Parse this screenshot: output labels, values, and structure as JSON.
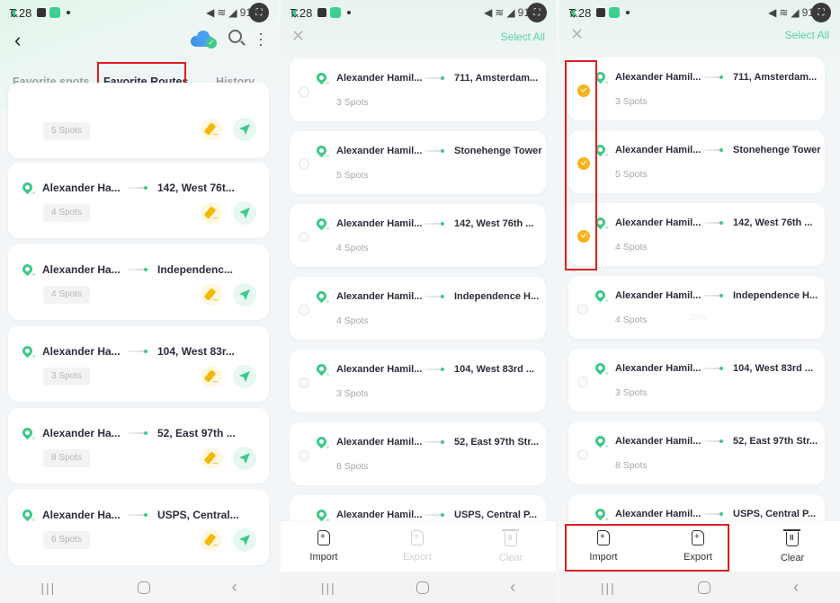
{
  "status_bar": {
    "time": "7:28",
    "battery": "91"
  },
  "panel1": {
    "tabs": [
      {
        "label": "Favorite spots",
        "active": false
      },
      {
        "label": "Favorite Routes",
        "active": true
      },
      {
        "label": "History",
        "active": false
      }
    ],
    "icons": {
      "back": "back-arrow-icon",
      "cloud": "cloud-sync-icon",
      "search": "search-icon",
      "menu": "more-vertical-icon"
    },
    "routes": [
      {
        "from": "",
        "to": "",
        "spots": "5 Spots"
      },
      {
        "from": "Alexander Ha...",
        "to": "142, West 76t...",
        "spots": "4 Spots"
      },
      {
        "from": "Alexander Ha...",
        "to": "Independenc...",
        "spots": "4 Spots"
      },
      {
        "from": "Alexander Ha...",
        "to": "104, West 83r...",
        "spots": "3 Spots"
      },
      {
        "from": "Alexander Ha...",
        "to": "52, East 97th ...",
        "spots": "8 Spots"
      },
      {
        "from": "Alexander Ha...",
        "to": "USPS, Central...",
        "spots": "6 Spots"
      }
    ]
  },
  "panel2": {
    "select_all": "Select All",
    "routes": [
      {
        "from": "Alexander Hamil...",
        "to": "711, Amsterdam...",
        "spots": "3 Spots",
        "checked": false
      },
      {
        "from": "Alexander Hamil...",
        "to": "Stonehenge Tower",
        "spots": "5 Spots",
        "checked": false
      },
      {
        "from": "Alexander Hamil...",
        "to": "142, West 76th ...",
        "spots": "4 Spots",
        "checked": false
      },
      {
        "from": "Alexander Hamil...",
        "to": "Independence H...",
        "spots": "4 Spots",
        "checked": false
      },
      {
        "from": "Alexander Hamil...",
        "to": "104, West 83rd ...",
        "spots": "3 Spots",
        "checked": false
      },
      {
        "from": "Alexander Hamil...",
        "to": "52, East 97th Str...",
        "spots": "8 Spots",
        "checked": false
      },
      {
        "from": "Alexander Hamil...",
        "to": "USPS, Central P...",
        "spots": "",
        "checked": false
      }
    ],
    "actions": [
      {
        "label": "Import",
        "enabled": true
      },
      {
        "label": "Export",
        "enabled": false
      },
      {
        "label": "Clear",
        "enabled": false
      }
    ]
  },
  "panel3": {
    "select_all": "Select All",
    "routes": [
      {
        "from": "Alexander Hamil...",
        "to": "711, Amsterdam...",
        "spots": "3 Spots",
        "checked": true
      },
      {
        "from": "Alexander Hamil...",
        "to": "Stonehenge Tower",
        "spots": "5 Spots",
        "checked": true
      },
      {
        "from": "Alexander Hamil...",
        "to": "142, West 76th ...",
        "spots": "4 Spots",
        "checked": true
      },
      {
        "from": "Alexander Hamil...",
        "to": "Independence H...",
        "spots": "4 Spots",
        "checked": false
      },
      {
        "from": "Alexander Hamil...",
        "to": "104, West 83rd ...",
        "spots": "3 Spots",
        "checked": false
      },
      {
        "from": "Alexander Hamil...",
        "to": "52, East 97th Str...",
        "spots": "8 Spots",
        "checked": false
      },
      {
        "from": "Alexander Hamil...",
        "to": "USPS, Central P...",
        "spots": "",
        "checked": false
      }
    ],
    "actions": [
      {
        "label": "Import",
        "enabled": true
      },
      {
        "label": "Export",
        "enabled": true
      },
      {
        "label": "Clear",
        "enabled": true
      }
    ],
    "watermark": "36%"
  },
  "colors": {
    "accent_green": "#3ec98a",
    "checked_yellow": "#f5b41f",
    "highlight_red": "#e01e1e",
    "edit_yellow": "#f5b800"
  }
}
